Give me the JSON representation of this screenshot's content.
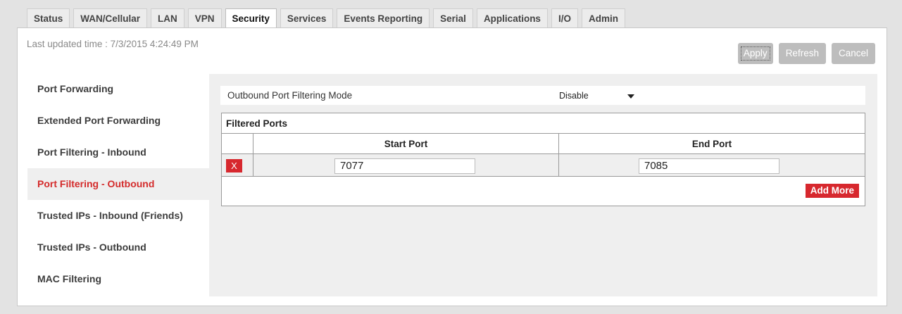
{
  "tabs": [
    {
      "label": "Status",
      "active": false
    },
    {
      "label": "WAN/Cellular",
      "active": false
    },
    {
      "label": "LAN",
      "active": false
    },
    {
      "label": "VPN",
      "active": false
    },
    {
      "label": "Security",
      "active": true
    },
    {
      "label": "Services",
      "active": false
    },
    {
      "label": "Events Reporting",
      "active": false
    },
    {
      "label": "Serial",
      "active": false
    },
    {
      "label": "Applications",
      "active": false
    },
    {
      "label": "I/O",
      "active": false
    },
    {
      "label": "Admin",
      "active": false
    }
  ],
  "header": {
    "last_updated": "Last updated time : 7/3/2015 4:24:49 PM",
    "apply_label": "Apply",
    "refresh_label": "Refresh",
    "cancel_label": "Cancel"
  },
  "sidebar": {
    "items": [
      {
        "label": "Port Forwarding",
        "active": false
      },
      {
        "label": "Extended Port Forwarding",
        "active": false
      },
      {
        "label": "Port Filtering - Inbound",
        "active": false
      },
      {
        "label": "Port Filtering - Outbound",
        "active": true
      },
      {
        "label": "Trusted IPs - Inbound (Friends)",
        "active": false
      },
      {
        "label": "Trusted IPs - Outbound",
        "active": false
      },
      {
        "label": "MAC Filtering",
        "active": false
      }
    ]
  },
  "main": {
    "mode_label": "Outbound Port Filtering Mode",
    "mode_value": "Disable",
    "filtered_ports": {
      "title": "Filtered Ports",
      "columns": [
        "Start Port",
        "End Port"
      ],
      "rows": [
        {
          "delete_label": "X",
          "start_port": "7077",
          "end_port": "7085"
        }
      ],
      "add_more_label": "Add More"
    }
  },
  "colors": {
    "accent_red": "#d7282e",
    "disabled_button": "#bdbdbd",
    "page_background": "#e3e3e3"
  }
}
